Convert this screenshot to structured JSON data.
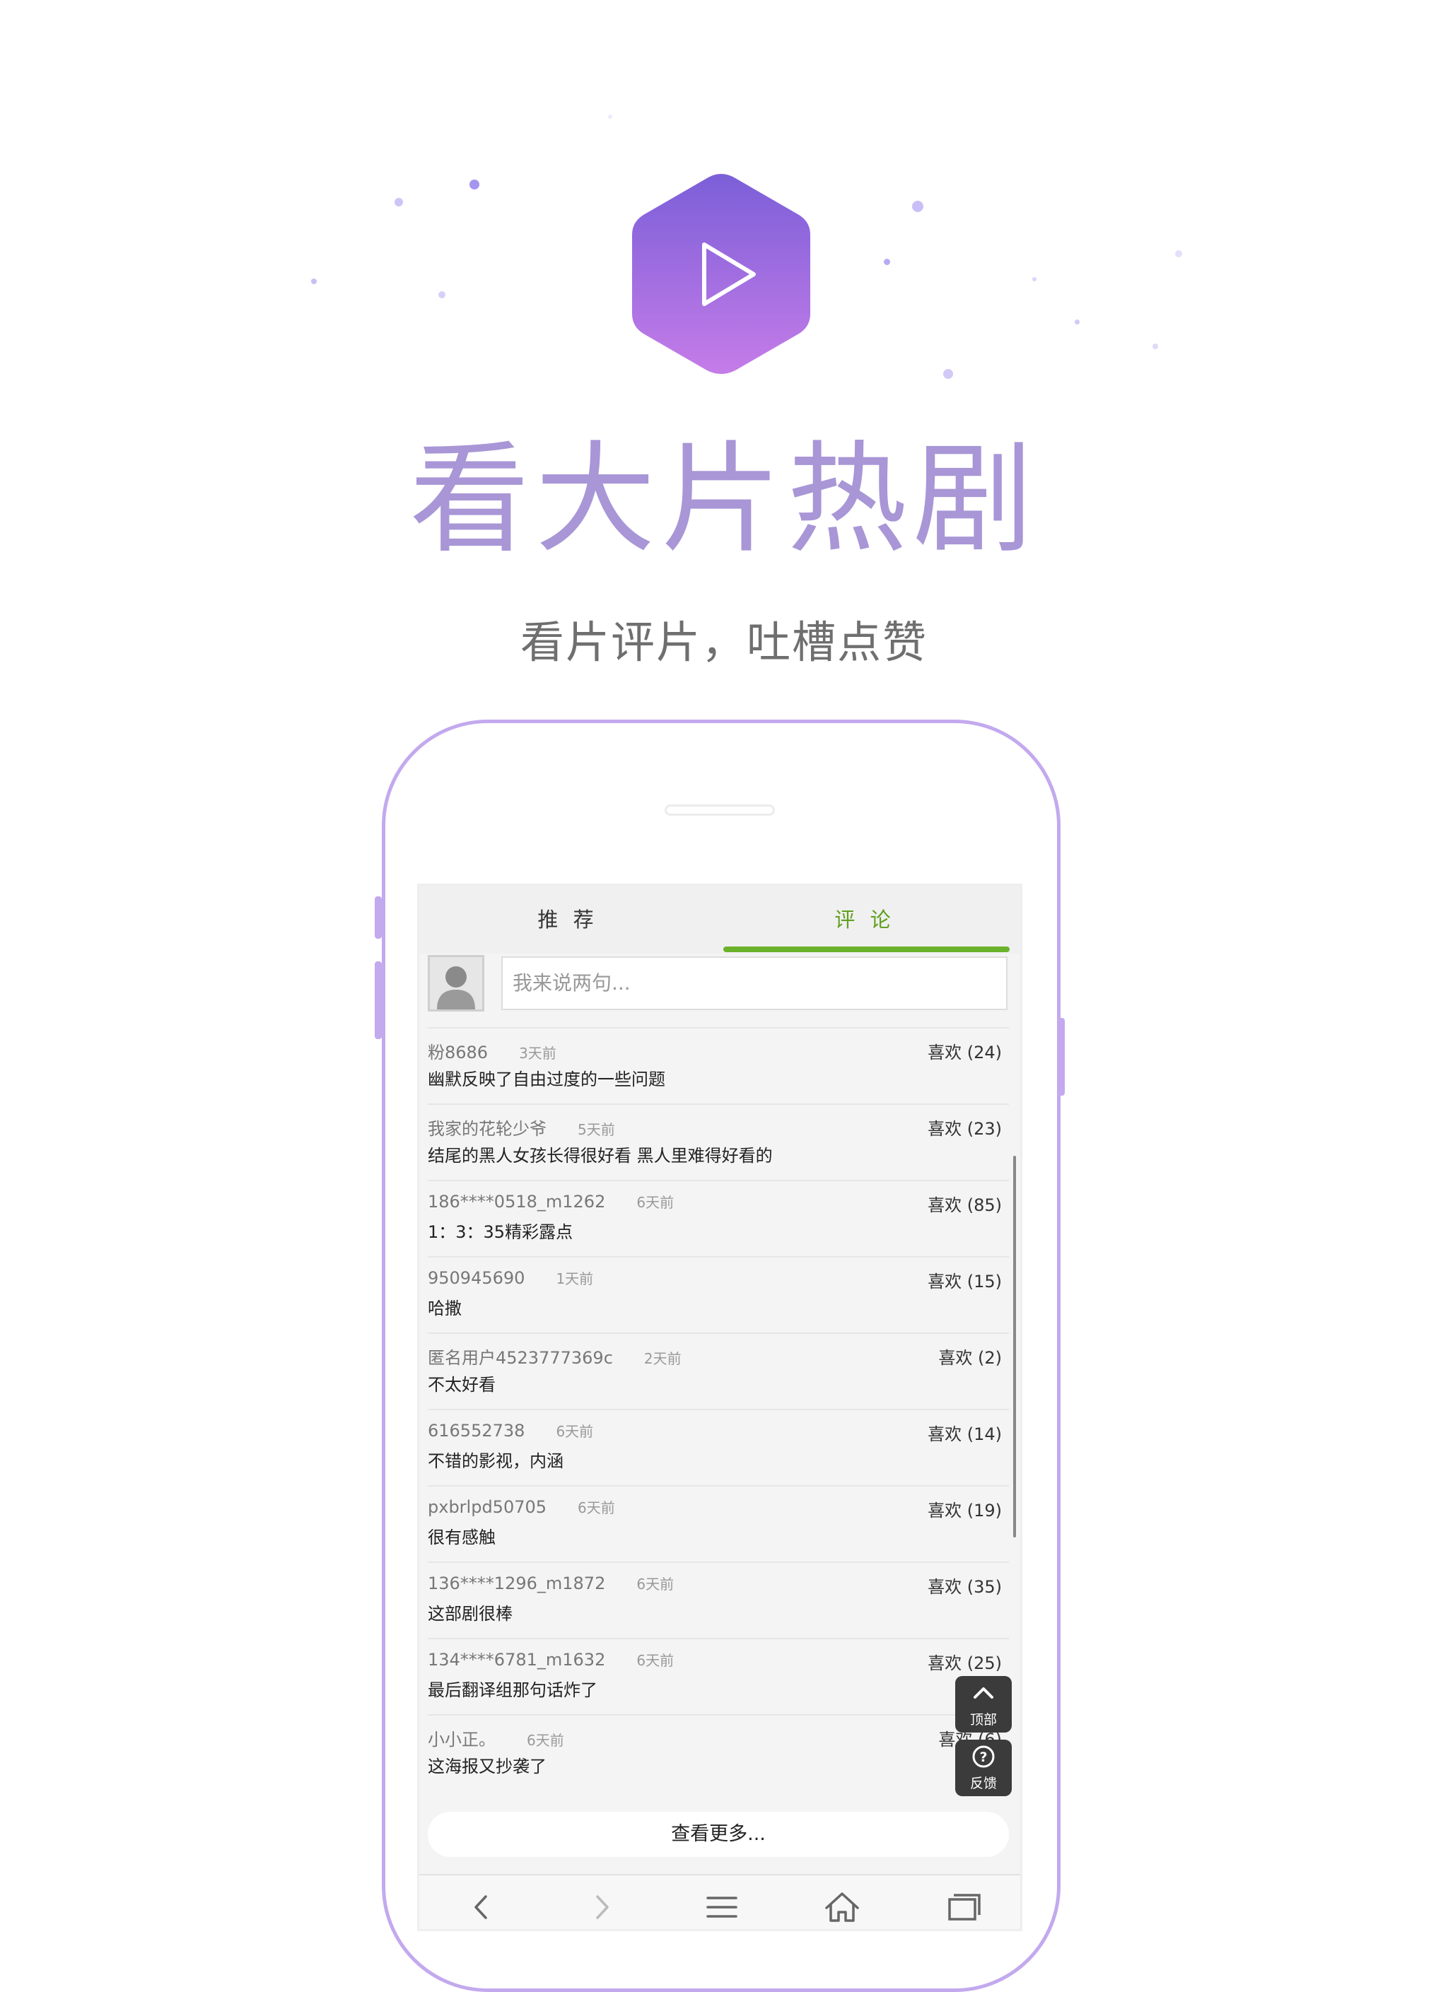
{
  "hero": {
    "headline": "看大片热剧",
    "tagline": "看片评片，吐槽点赞"
  },
  "logo": {
    "icon": "play-icon",
    "gradient": [
      "#7b5fd8",
      "#c57ce8"
    ]
  },
  "tabs": [
    {
      "label": "推 荐",
      "active": false
    },
    {
      "label": "评 论",
      "active": true
    }
  ],
  "colors": {
    "accent": "#6ab22a",
    "phone_outline": "#c3a9ee",
    "headline": "#a896d6"
  },
  "comment_box": {
    "placeholder": "我来说两句..."
  },
  "comments": [
    {
      "user": "粉8686",
      "time": "3天前",
      "likes": "喜欢 (24)",
      "text": "幽默反映了自由过度的一些问题"
    },
    {
      "user": "我家的花轮少爷",
      "time": "5天前",
      "likes": "喜欢 (23)",
      "text": "结尾的黑人女孩长得很好看 黑人里难得好看的"
    },
    {
      "user": "186****0518_m1262",
      "time": "6天前",
      "likes": "喜欢 (85)",
      "text": "1：3：35精彩露点"
    },
    {
      "user": "950945690",
      "time": "1天前",
      "likes": "喜欢 (15)",
      "text": "哈撒"
    },
    {
      "user": "匿名用户4523777369c",
      "time": "2天前",
      "likes": "喜欢 (2)",
      "text": "不太好看"
    },
    {
      "user": "616552738",
      "time": "6天前",
      "likes": "喜欢 (14)",
      "text": "不错的影视，内涵"
    },
    {
      "user": "pxbrlpd50705",
      "time": "6天前",
      "likes": "喜欢 (19)",
      "text": "很有感触"
    },
    {
      "user": "136****1296_m1872",
      "time": "6天前",
      "likes": "喜欢 (35)",
      "text": "这部剧很棒"
    },
    {
      "user": "134****6781_m1632",
      "time": "6天前",
      "likes": "喜欢 (25)",
      "text": "最后翻译组那句话炸了"
    },
    {
      "user": "小小正。",
      "time": "6天前",
      "likes": "喜欢 (6)",
      "text": "这海报又抄袭了"
    }
  ],
  "floating": {
    "top_label": "顶部",
    "feedback_label": "反馈"
  },
  "more_label": "查看更多...",
  "bottom_nav": [
    "back-icon",
    "forward-icon",
    "menu-icon",
    "home-icon",
    "tabs-icon"
  ]
}
